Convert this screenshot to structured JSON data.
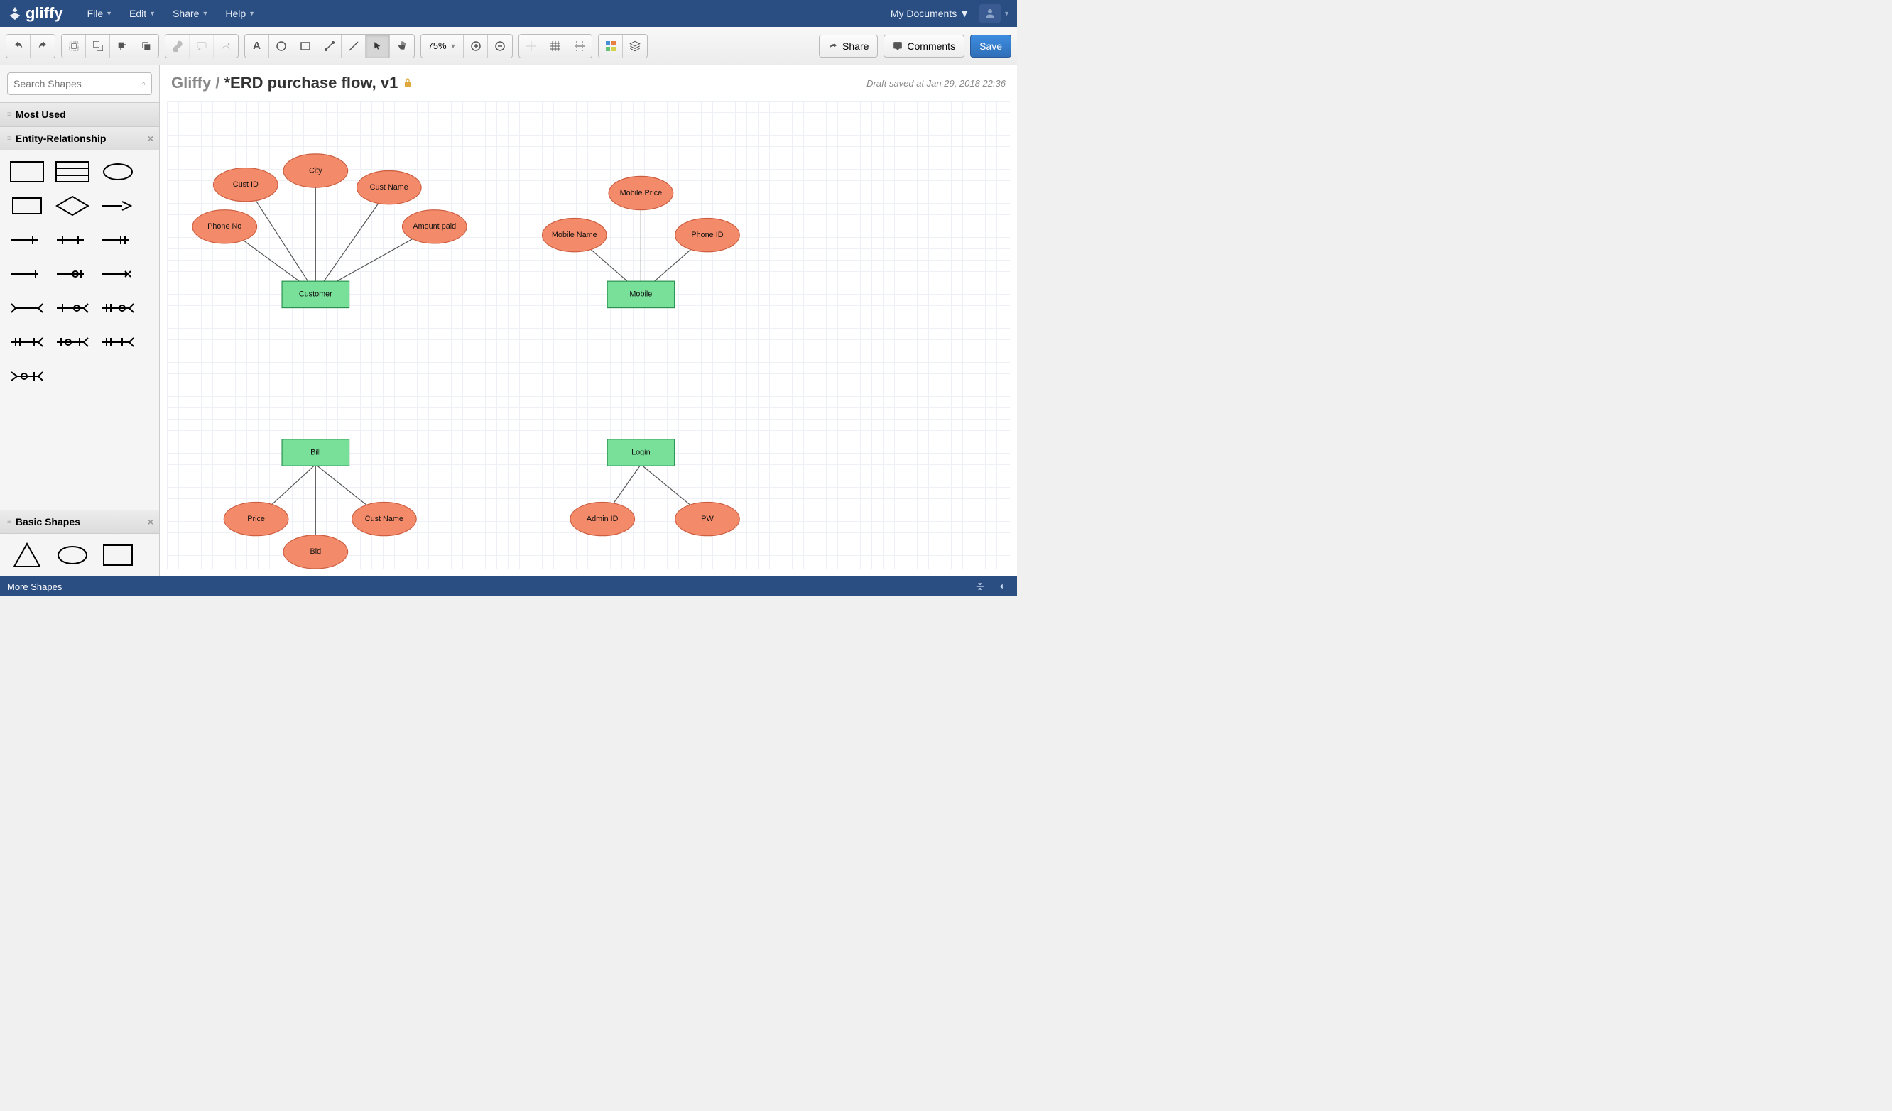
{
  "header": {
    "brand": "gliffy",
    "menus": [
      "File",
      "Edit",
      "Share",
      "Help"
    ],
    "my_documents": "My Documents"
  },
  "toolbar": {
    "zoom": "75%",
    "share": "Share",
    "comments": "Comments",
    "save": "Save"
  },
  "sidebar": {
    "search_placeholder": "Search Shapes",
    "most_used": "Most Used",
    "entity_relationship": "Entity-Relationship",
    "basic_shapes": "Basic Shapes"
  },
  "doc": {
    "crumb": "Gliffy /",
    "title": "*ERD purchase flow, v1",
    "draft_saved": "Draft saved at Jan 29, 2018 22:36"
  },
  "diagram": {
    "entities": {
      "customer": "Customer",
      "mobile": "Mobile",
      "bill": "Bill",
      "login": "Login"
    },
    "attributes": {
      "phone_no": "Phone No",
      "cust_id": "Cust ID",
      "city": "City",
      "cust_name": "Cust Name",
      "amount_paid": "Amount paid",
      "mobile_name": "Mobile Name",
      "mobile_price": "Mobile Price",
      "phone_id": "Phone ID",
      "price": "Price",
      "bid": "Bid",
      "cust_name2": "Cust Name",
      "admin_id": "Admin ID",
      "pw": "PW"
    }
  },
  "footer": {
    "more_shapes": "More Shapes"
  }
}
